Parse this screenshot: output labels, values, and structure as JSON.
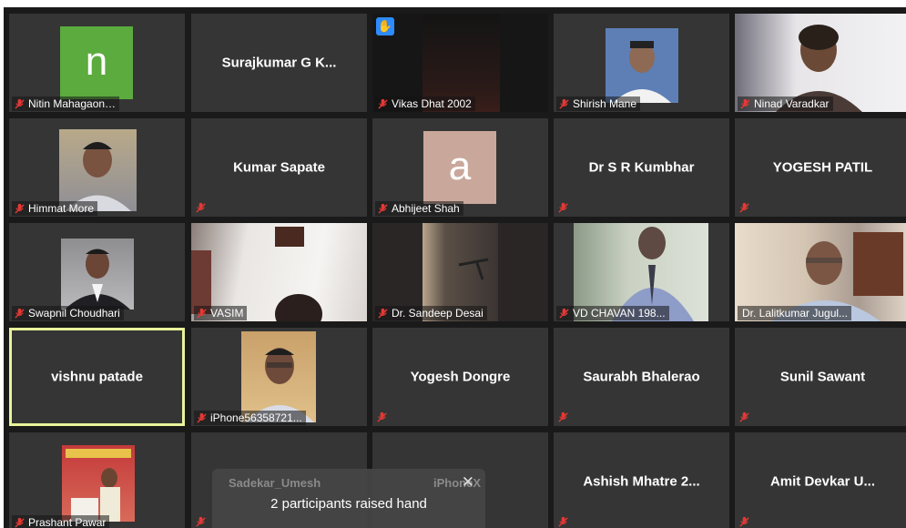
{
  "participants": [
    {
      "name": "Nitin Mahagaon…",
      "avatar_letter": "n",
      "avatar_color": "#5bab3e"
    },
    {
      "center_name": "Surajkumar G K..."
    },
    {
      "name": "Vikas Dhat 2002",
      "hand_raised_icon": "hand-icon"
    },
    {
      "name": "Shirish Mane"
    },
    {
      "name": "Ninad Varadkar"
    },
    {
      "name": "Himmat More"
    },
    {
      "center_name": "Kumar Sapate"
    },
    {
      "name": "Abhijeet Shah",
      "avatar_letter": "a",
      "avatar_color": "#c9a89b"
    },
    {
      "center_name": "Dr S R Kumbhar"
    },
    {
      "center_name": "YOGESH PATIL"
    },
    {
      "name": "Swapnil Choudhari"
    },
    {
      "name": "VASIM"
    },
    {
      "name": "Dr. Sandeep Desai"
    },
    {
      "name": "VD CHAVAN 198..."
    },
    {
      "name": "Dr. Lalitkumar Jugul..."
    },
    {
      "center_name": "vishnu patade",
      "active_speaker": true
    },
    {
      "name": "iPhone56358721..."
    },
    {
      "center_name": "Yogesh Dongre"
    },
    {
      "center_name": "Saurabh Bhalerao"
    },
    {
      "center_name": "Sunil Sawant"
    },
    {
      "name": "Prashant Pawar"
    },
    {},
    {},
    {
      "center_name": "Ashish Mhatre 2..."
    },
    {
      "center_name": "Amit Devkar  U..."
    }
  ],
  "notification": {
    "message": "2 participants raised hand",
    "ghost_left": "Sadekar_Umesh",
    "ghost_right": "iPhoneX",
    "close_icon": "close-icon"
  },
  "colors": {
    "muted_mic": "#e53935",
    "active_speaker_border": "#e9f39a",
    "tile_bg": "#353535"
  }
}
